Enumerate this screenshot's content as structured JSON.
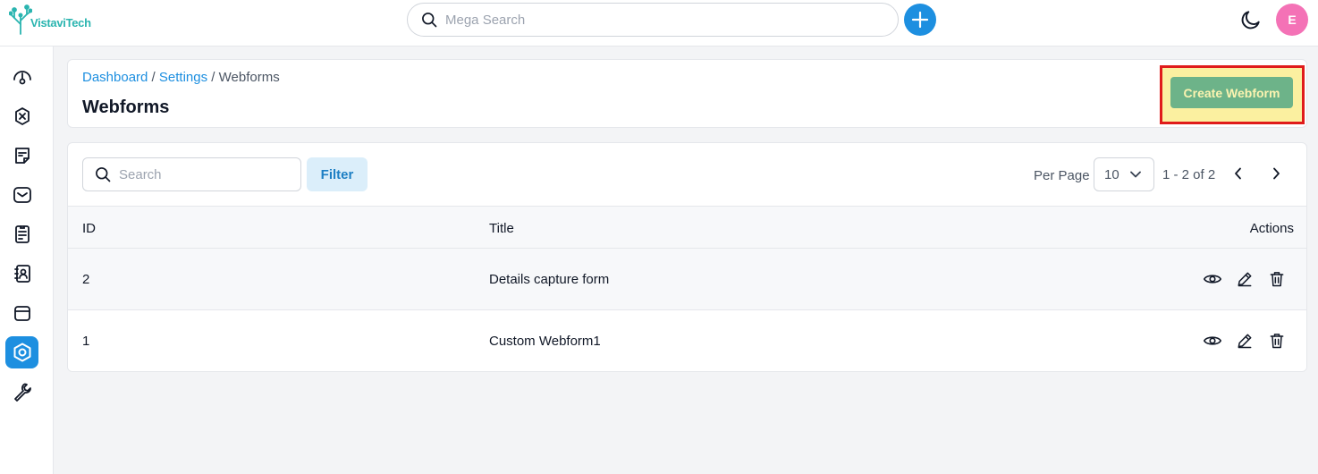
{
  "app": {
    "logo_text": "VistaviTech"
  },
  "topbar": {
    "search_placeholder": "Mega Search",
    "avatar_initial": "E"
  },
  "sidebar": {
    "items": [
      {
        "name": "dashboard-icon"
      },
      {
        "name": "integrations-icon"
      },
      {
        "name": "notes-icon"
      },
      {
        "name": "mail-icon"
      },
      {
        "name": "tasks-icon"
      },
      {
        "name": "contacts-icon"
      },
      {
        "name": "archive-icon"
      },
      {
        "name": "settings-icon",
        "active": true
      },
      {
        "name": "tools-icon"
      }
    ]
  },
  "header": {
    "breadcrumb": [
      "Dashboard",
      "Settings",
      "Webforms"
    ],
    "separator": " / ",
    "title": "Webforms",
    "create_label": "Create Webform"
  },
  "toolbar": {
    "search_placeholder": "Search",
    "filter_label": "Filter",
    "per_page_label": "Per Page",
    "per_page_value": "10",
    "range_text": "1 - 2 of 2"
  },
  "table": {
    "columns": [
      "ID",
      "Title",
      "Actions"
    ],
    "rows": [
      {
        "id": "2",
        "title": "Details capture form"
      },
      {
        "id": "1",
        "title": "Custom Webform1"
      }
    ]
  },
  "colors": {
    "accent": "#1d8fe0",
    "create_button": "#6db389",
    "highlight_border": "#e01b1b",
    "highlight_fill": "#fbf0a0",
    "avatar": "#f472b6"
  }
}
